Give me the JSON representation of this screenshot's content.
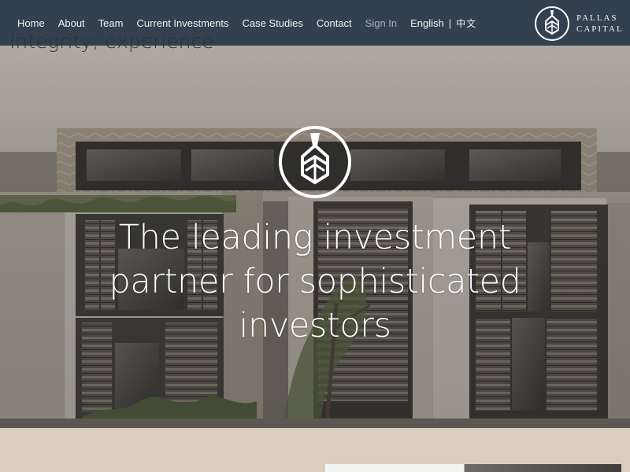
{
  "nav": {
    "items": [
      {
        "label": "Home"
      },
      {
        "label": "About"
      },
      {
        "label": "Team"
      },
      {
        "label": "Current Investments"
      },
      {
        "label": "Case Studies"
      },
      {
        "label": "Contact"
      },
      {
        "label": "Sign In"
      }
    ],
    "language": {
      "label": "English",
      "separator": "|",
      "other_label": "中文"
    }
  },
  "brand": {
    "line1": "PALLAS",
    "line2": "CAPITAL",
    "icon": "pallas-helmet-icon"
  },
  "hero": {
    "logo_icon": "pallas-helmet-icon",
    "title": "The leading investment partner for sophisticated investors"
  },
  "section": {
    "heading_partial": "Integrity, experience"
  },
  "colors": {
    "header_bg": "#324050",
    "nav_text": "#f2f2f2",
    "sign_in_text": "#a8b1bc",
    "content_bg": "#dacdbd",
    "hero_text": "#ffffff"
  }
}
